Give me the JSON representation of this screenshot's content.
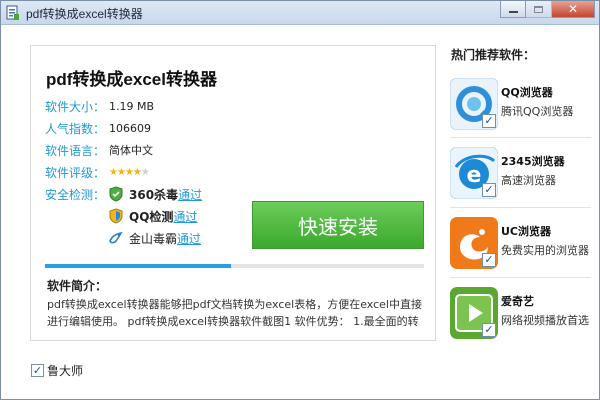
{
  "window": {
    "title": "pdf转换成excel转换器",
    "close_glyph": "✕"
  },
  "app": {
    "name": "pdf转换成excel转换器",
    "info": [
      {
        "label": "软件大小：",
        "value": "1.19 MB"
      },
      {
        "label": "人气指数：",
        "value": "106609"
      },
      {
        "label": "软件语言：",
        "value": "简体中文"
      }
    ],
    "rating_label": "软件评级：",
    "rating_stars": 4,
    "rating_max": 5,
    "security_label": "安全检测：",
    "scans": [
      {
        "name": "360杀毒",
        "status": "通过",
        "icon": "360-shield-icon"
      },
      {
        "name": "QQ检测",
        "status": "通过",
        "icon": "qq-shield-icon"
      },
      {
        "name": "金山毒霸",
        "status": "通过",
        "icon": "kingsoft-icon"
      }
    ],
    "install_label": "快速安装",
    "progress_fraction": 0.49,
    "intro_title": "软件简介：",
    "intro_text": "pdf转换成excel转换器能够把pdf文档转换为excel表格，方便在excel中直接进行编辑使用。 pdf转换成excel转换器软件截图1 软件优势： 1.最全面的转换"
  },
  "recommend": {
    "title": "热门推荐软件：",
    "items": [
      {
        "name": "QQ浏览器",
        "desc": "腾讯QQ浏览器",
        "checked": true,
        "logo": "qq-browser-icon",
        "color": "#2f8fd8"
      },
      {
        "name": "2345浏览器",
        "desc": "高速浏览器",
        "checked": true,
        "logo": "2345-browser-icon",
        "color": "#1d8ad6"
      },
      {
        "name": "UC浏览器",
        "desc": "免费实用的浏览器",
        "checked": true,
        "logo": "uc-browser-icon",
        "color": "#f07a1a"
      },
      {
        "name": "爱奇艺",
        "desc": "网络视频播放首选",
        "checked": true,
        "logo": "iqiyi-icon",
        "color": "#5aa832"
      }
    ]
  },
  "footer": {
    "checkbox_label": "鲁大师",
    "checked": true
  }
}
